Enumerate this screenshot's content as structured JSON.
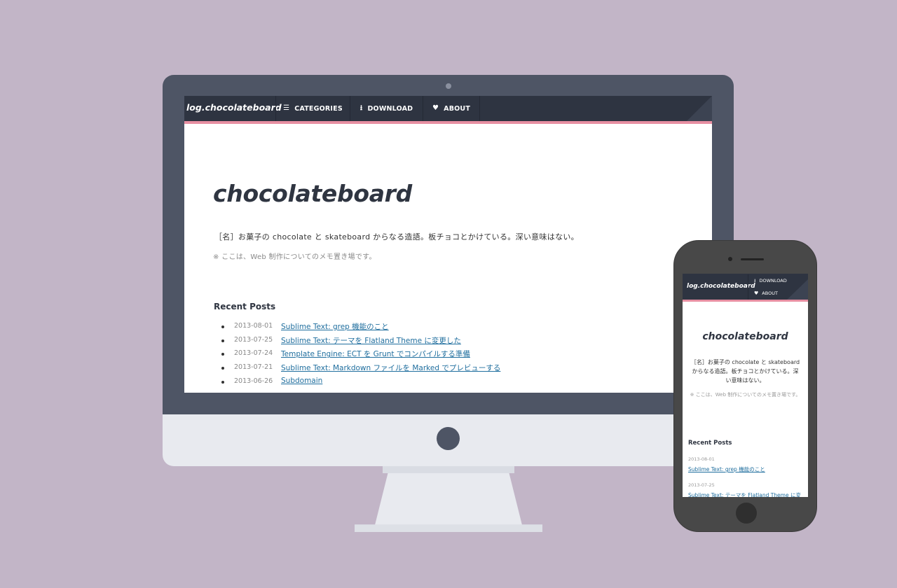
{
  "site": {
    "logo": "log.chocolateboard",
    "title": "chocolateboard",
    "description": "［名］お菓子の chocolate と skateboard からなる造語。板チョコとかけている。深い意味はない。",
    "note": "※ ここは、Web 制作についてのメモ置き場です。",
    "recent_heading": "Recent Posts"
  },
  "nav": {
    "categories": "CATEGORIES",
    "download": "DOWNLOAD",
    "about": "ABOUT"
  },
  "mobile_nav": {
    "download": "DOWNLOAD",
    "about": "ABOUT"
  },
  "posts": [
    {
      "date": "2013-08-01",
      "title": "Sublime Text: grep 機能のこと"
    },
    {
      "date": "2013-07-25",
      "title": "Sublime Text: テーマを Flatland Theme に変更した"
    },
    {
      "date": "2013-07-24",
      "title": "Template Engine: ECT を Grunt でコンパイルする準備"
    },
    {
      "date": "2013-07-21",
      "title": "Sublime Text: Markdown ファイルを Marked でプレビューする"
    },
    {
      "date": "2013-06-26",
      "title": "Subdomain"
    }
  ],
  "mobile_posts": [
    {
      "date": "2013-08-01",
      "title": "Sublime Text: grep 機能のこと"
    },
    {
      "date": "2013-07-25",
      "title": "Sublime Text: テーマを Flatland Theme に変"
    }
  ],
  "icons": {
    "categories": "list-icon",
    "download": "download-icon",
    "about": "heart-icon"
  },
  "colors": {
    "background": "#c2b5c7",
    "nav": "#2e3441",
    "accent_stripe": "#e78fa2",
    "link": "#1f6e9e",
    "monitor": "#4e5565"
  }
}
